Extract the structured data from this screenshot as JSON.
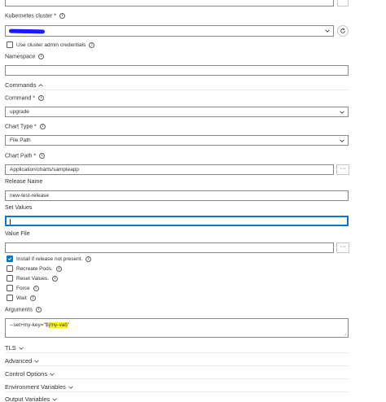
{
  "kubernetes_cluster": {
    "label": "Kubernetes cluster *",
    "use_admin_label": "Use cluster admin credentials"
  },
  "namespace": {
    "label": "Namespace",
    "value": ""
  },
  "commands_section": {
    "label": "Commands"
  },
  "command": {
    "label": "Command *",
    "value": "upgrade"
  },
  "chart_type": {
    "label": "Chart Type *",
    "value": "File Path"
  },
  "chart_path": {
    "label": "Chart Path *",
    "value": "Application/charts/sampleapp",
    "browse": "···"
  },
  "release_name": {
    "label": "Release Name",
    "value": "new-test-release"
  },
  "set_values": {
    "label": "Set Values",
    "value": ""
  },
  "value_file": {
    "label": "Value File",
    "value": "",
    "browse": "···"
  },
  "options": {
    "install": "Install if release not present.",
    "recreate": "Recreate Pods.",
    "reset": "Reset Values.",
    "force": "Force",
    "wait": "Wait"
  },
  "arguments": {
    "label": "Arguments",
    "prefix": "--set+my-key=\"$",
    "highlight": "(my-val)",
    "suffix": "\""
  },
  "sections": {
    "tls": "TLS",
    "advanced": "Advanced",
    "control_options": "Control Options",
    "environment_variables": "Environment Variables",
    "output_variables": "Output Variables"
  },
  "colors": {
    "accent": "#0078d4",
    "redacted": "#1a1aff",
    "highlight": "#ffff00"
  }
}
